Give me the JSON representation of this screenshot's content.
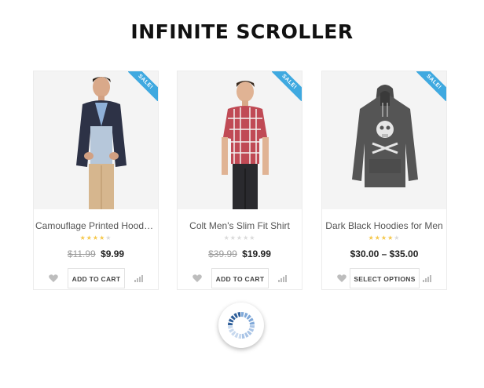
{
  "title": "INFINITE SCROLLER",
  "products": [
    {
      "badge": "SALE!",
      "name": "Camouflage Printed Hooded ...",
      "rating": 4,
      "old_price": "$11.99",
      "price": "$9.99",
      "action": "ADD TO CART",
      "image_icon": "man-in-pea-coat"
    },
    {
      "badge": "SALE!",
      "name": "Colt Men's Slim Fit Shirt",
      "rating": 0,
      "old_price": "$39.99",
      "price": "$19.99",
      "action": "ADD TO CART",
      "image_icon": "man-in-plaid-shirt"
    },
    {
      "badge": "SALE!",
      "name": "Dark Black Hoodies for Men",
      "rating": 4,
      "old_price": "",
      "price": "$30.00 – $35.00",
      "action": "SELECT OPTIONS",
      "image_icon": "skull-print-hoodie"
    }
  ],
  "colors": {
    "badge": "#3fa9e0",
    "star": "#f5c84c",
    "loader": "#7fa8d8"
  },
  "loader_icon": "spinner-icon"
}
